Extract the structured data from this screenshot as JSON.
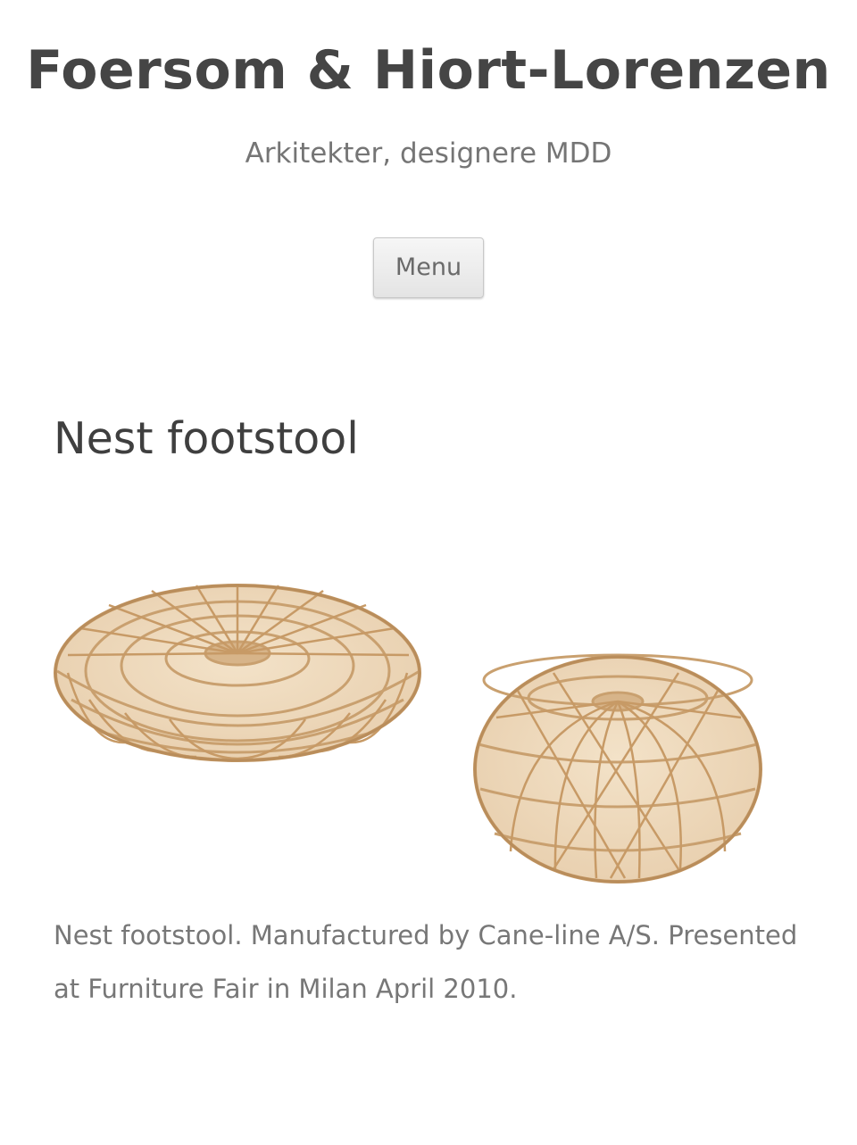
{
  "header": {
    "site_title": "Foersom & Hiort-Lorenzen",
    "site_description": "Arkitekter, designere MDD"
  },
  "navigation": {
    "menu_label": "Menu"
  },
  "entry": {
    "title": "Nest footstool",
    "image": {
      "subject": "two rattan nest footstools, large low and small round",
      "color": "#d9b58a"
    },
    "caption": "Nest footstool. Manufactured by Cane-line A/S. Presented at Furniture Fair in Milan April 2010."
  }
}
